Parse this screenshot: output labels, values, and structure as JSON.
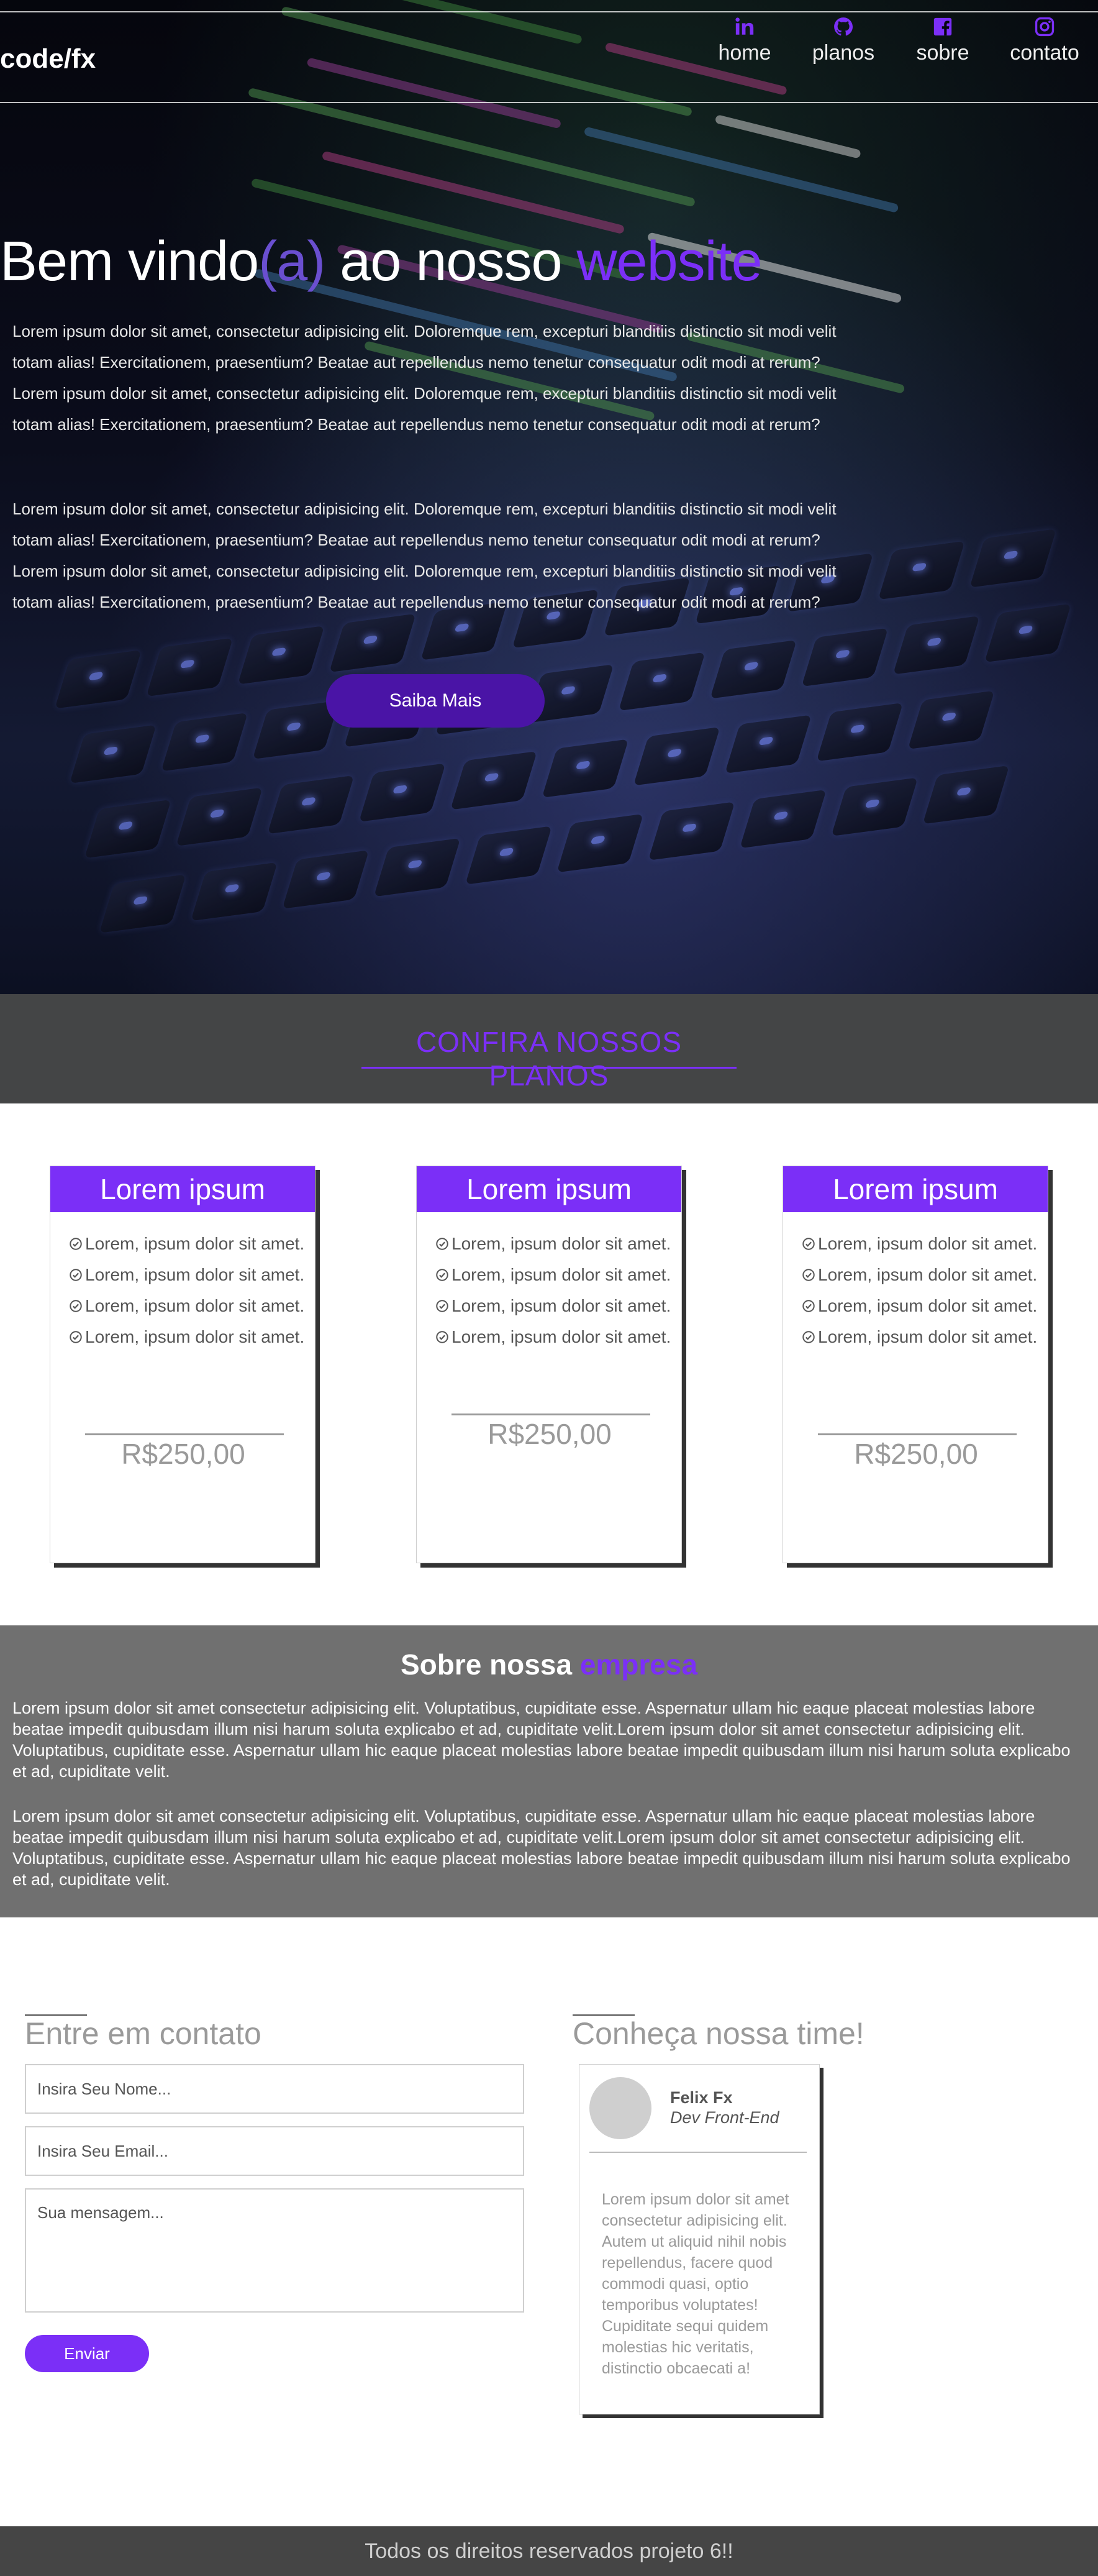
{
  "brand": {
    "logo": "code/fx"
  },
  "nav": {
    "items": [
      {
        "label": "home",
        "icon": "linkedin-icon"
      },
      {
        "label": "planos",
        "icon": "github-icon"
      },
      {
        "label": "sobre",
        "icon": "facebook-icon"
      },
      {
        "label": "contato",
        "icon": "instagram-icon"
      }
    ]
  },
  "hero": {
    "title_part1": "Bem vindo",
    "title_part2": "(a)",
    "title_part3": " ao nosso ",
    "title_part4": "website",
    "paragraphs": [
      "Lorem ipsum dolor sit amet, consectetur adipisicing elit. Doloremque rem, excepturi blanditiis distinctio sit modi velit totam alias! Exercitationem, praesentium? Beatae aut repellendus nemo tenetur consequatur odit modi at rerum? Lorem ipsum dolor sit amet, consectetur adipisicing elit. Doloremque rem, excepturi blanditiis distinctio sit modi velit totam alias! Exercitationem, praesentium? Beatae aut repellendus nemo tenetur consequatur odit modi at rerum?",
      "Lorem ipsum dolor sit amet, consectetur adipisicing elit. Doloremque rem, excepturi blanditiis distinctio sit modi velit totam alias! Exercitationem, praesentium? Beatae aut repellendus nemo tenetur consequatur odit modi at rerum? Lorem ipsum dolor sit amet, consectetur adipisicing elit. Doloremque rem, excepturi blanditiis distinctio sit modi velit totam alias! Exercitationem, praesentium? Beatae aut repellendus nemo tenetur consequatur odit modi at rerum?"
    ],
    "cta_label": "Saiba Mais"
  },
  "plans": {
    "title": "CONFIRA NOSSOS PLANOS",
    "cards": [
      {
        "title": "Lorem ipsum",
        "features": [
          "Lorem, ipsum dolor sit amet.",
          "Lorem, ipsum dolor sit amet.",
          "Lorem, ipsum dolor sit amet.",
          "Lorem, ipsum dolor sit amet."
        ],
        "price": "R$250,00"
      },
      {
        "title": "Lorem ipsum",
        "features": [
          "Lorem, ipsum dolor sit amet.",
          "Lorem, ipsum dolor sit amet.",
          "Lorem, ipsum dolor sit amet.",
          "Lorem, ipsum dolor sit amet."
        ],
        "price": "R$250,00"
      },
      {
        "title": "Lorem ipsum",
        "features": [
          "Lorem, ipsum dolor sit amet.",
          "Lorem, ipsum dolor sit amet.",
          "Lorem, ipsum dolor sit amet.",
          "Lorem, ipsum dolor sit amet."
        ],
        "price": "R$250,00"
      }
    ]
  },
  "about": {
    "title_part1": "Sobre nossa ",
    "title_part2": "empresa",
    "paragraphs": [
      "Lorem ipsum dolor sit amet consectetur adipisicing elit. Voluptatibus, cupiditate esse. Aspernatur ullam hic eaque placeat molestias labore beatae impedit quibusdam illum nisi harum soluta explicabo et ad, cupiditate velit.Lorem ipsum dolor sit amet consectetur adipisicing elit. Voluptatibus, cupiditate esse. Aspernatur ullam hic eaque placeat molestias labore beatae impedit quibusdam illum nisi harum soluta explicabo et ad, cupiditate velit.",
      "Lorem ipsum dolor sit amet consectetur adipisicing elit. Voluptatibus, cupiditate esse. Aspernatur ullam hic eaque placeat molestias labore beatae impedit quibusdam illum nisi harum soluta explicabo et ad, cupiditate velit.Lorem ipsum dolor sit amet consectetur adipisicing elit. Voluptatibus, cupiditate esse. Aspernatur ullam hic eaque placeat molestias labore beatae impedit quibusdam illum nisi harum soluta explicabo et ad, cupiditate velit."
    ]
  },
  "contact": {
    "title": "Entre em contato",
    "name_placeholder": "Insira Seu Nome...",
    "email_placeholder": "Insira Seu Email...",
    "message_placeholder": "Sua mensagem...",
    "send_label": "Enviar"
  },
  "team": {
    "title": "Conheça nossa time!",
    "member": {
      "name": "Felix Fx",
      "role": "Dev Front-End",
      "bio": "Lorem ipsum dolor sit amet consectetur adipisicing elit. Autem ut aliquid nihil nobis repellendus, facere quod commodi quasi, optio temporibus voluptates! Cupiditate sequi quidem molestias hic veritatis, distinctio obcaecati a!"
    }
  },
  "footer": {
    "text": "Todos os direitos reservados projeto 6!!"
  },
  "colors": {
    "accent": "#7b2ff7",
    "button_dark": "#4a14a6",
    "band": "#444546",
    "about_bg": "#707070",
    "footer_bg": "#454545"
  }
}
